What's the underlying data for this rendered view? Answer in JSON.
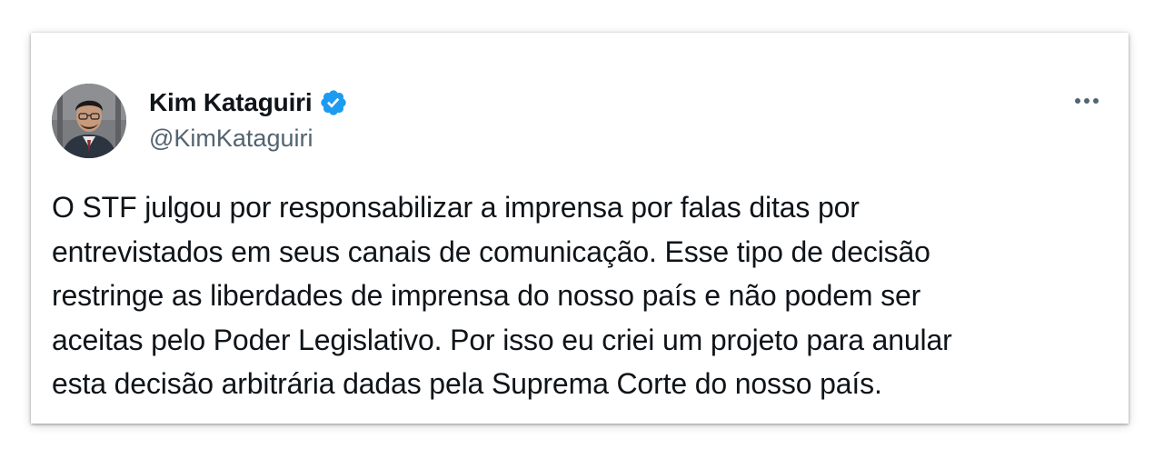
{
  "tweet": {
    "author": {
      "name": "Kim Kataguiri",
      "handle": "@KimKataguiri",
      "verified": true,
      "avatar_icon": "profile-photo"
    },
    "more_icon": "ellipsis-horizontal-icon",
    "text_lines": [
      "O STF julgou por responsabilizar a imprensa por falas ditas por",
      "entrevistados em seus canais de comunicação. Esse tipo de decisão",
      "restringe as liberdades de imprensa do nosso país e não podem ser",
      "aceitas pelo Poder Legislativo. Por isso eu criei um projeto para anular",
      "esta decisão arbitrária dadas pela Suprema Corte do nosso país."
    ]
  },
  "colors": {
    "text": "#0f1419",
    "secondary": "#536471",
    "verified_badge": "#1d9bf0",
    "background": "#ffffff"
  }
}
